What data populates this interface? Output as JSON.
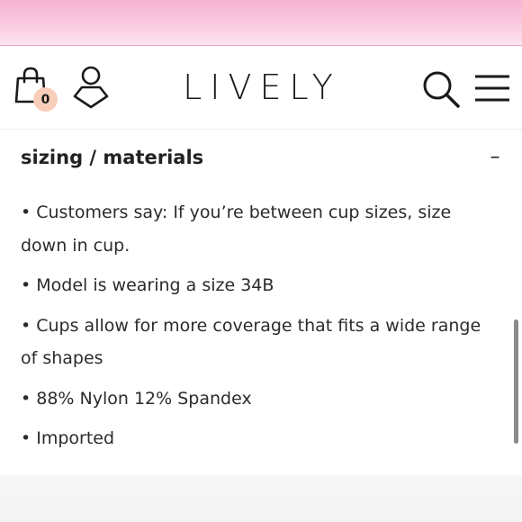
{
  "header": {
    "cart_count": "0",
    "logo": "LIVELY",
    "icons": [
      "shopping-bag-icon",
      "account-icon",
      "search-icon",
      "hamburger-menu-icon"
    ]
  },
  "section": {
    "title": "sizing / materials",
    "toggle": "–"
  },
  "bullets": [
    "• Customers say: If you’re between cup sizes, size down in cup.",
    "• Model is wearing a size 34B",
    "• Cups allow for more coverage that fits a wide range of shapes",
    "• 88% Nylon 12% Spandex",
    "• Imported"
  ],
  "colors": {
    "banner_pink": "#f7b3d2",
    "badge": "#f8cdb9",
    "text": "#2b2b2b"
  }
}
